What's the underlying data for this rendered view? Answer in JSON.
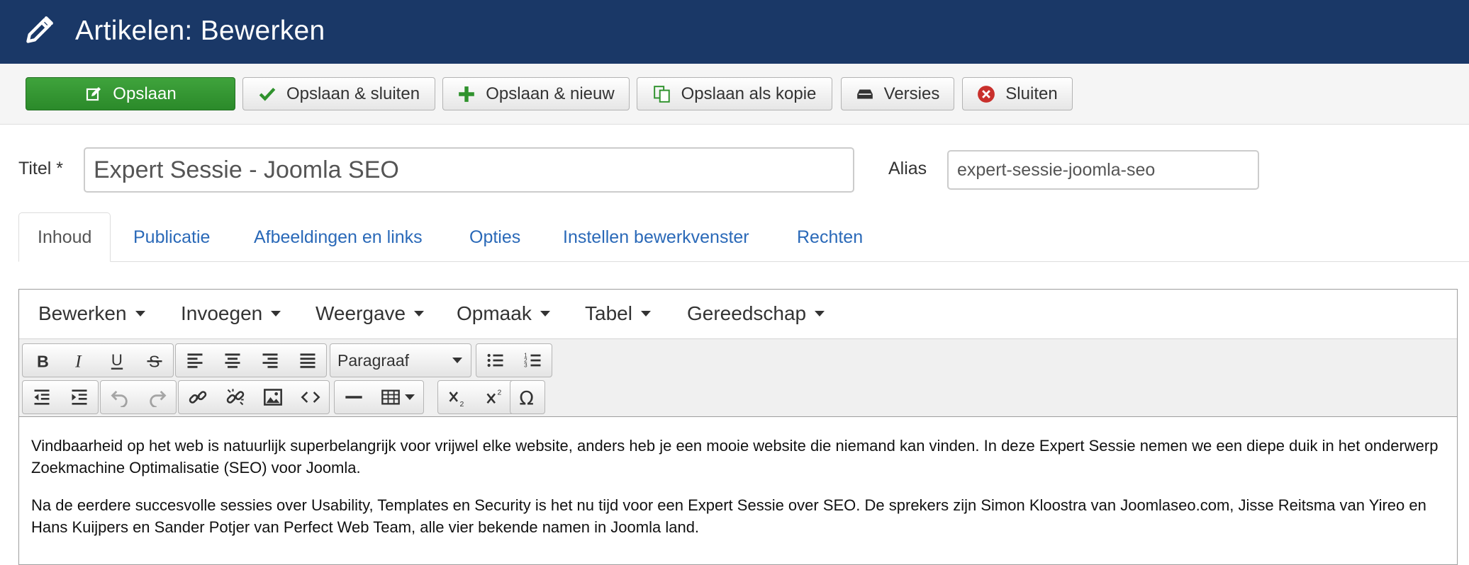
{
  "header": {
    "title": "Artikelen: Bewerken",
    "icon": "pencil-icon"
  },
  "toolbar": {
    "save_label": "Opslaan",
    "save_close_label": "Opslaan & sluiten",
    "save_new_label": "Opslaan & nieuw",
    "save_copy_label": "Opslaan als kopie",
    "versions_label": "Versies",
    "close_label": "Sluiten"
  },
  "form": {
    "title_label": "Titel *",
    "title_value": "Expert Sessie - Joomla SEO",
    "alias_label": "Alias",
    "alias_value": "expert-sessie-joomla-seo"
  },
  "tabs": [
    {
      "label": "Inhoud"
    },
    {
      "label": "Publicatie"
    },
    {
      "label": "Afbeeldingen en links"
    },
    {
      "label": "Opties"
    },
    {
      "label": "Instellen bewerkvenster"
    },
    {
      "label": "Rechten"
    }
  ],
  "editor": {
    "menus": [
      {
        "label": "Bewerken"
      },
      {
        "label": "Invoegen"
      },
      {
        "label": "Weergave"
      },
      {
        "label": "Opmaak"
      },
      {
        "label": "Tabel"
      },
      {
        "label": "Gereedschap"
      }
    ],
    "format_select": "Paragraaf",
    "paragraphs": [
      "Vindbaarheid op het web is natuurlijk superbelangrijk voor vrijwel elke website, anders heb je een mooie website die niemand kan vinden. In deze Expert Sessie nemen we een diepe duik in het onderwerp Zoekmachine Optimalisatie (SEO) voor Joomla.",
      "Na de eerdere succesvolle sessies over Usability, Templates en Security is het nu tijd voor een Expert Sessie over SEO. De sprekers zijn Simon Kloostra van Joomlaseo.com, Jisse Reitsma van Yireo en Hans Kuijpers en Sander Potjer van Perfect Web Team, alle vier bekende namen in Joomla land."
    ]
  },
  "colors": {
    "header_bg": "#1a3867",
    "primary_button": "#2f922d",
    "link": "#2a69b8"
  }
}
